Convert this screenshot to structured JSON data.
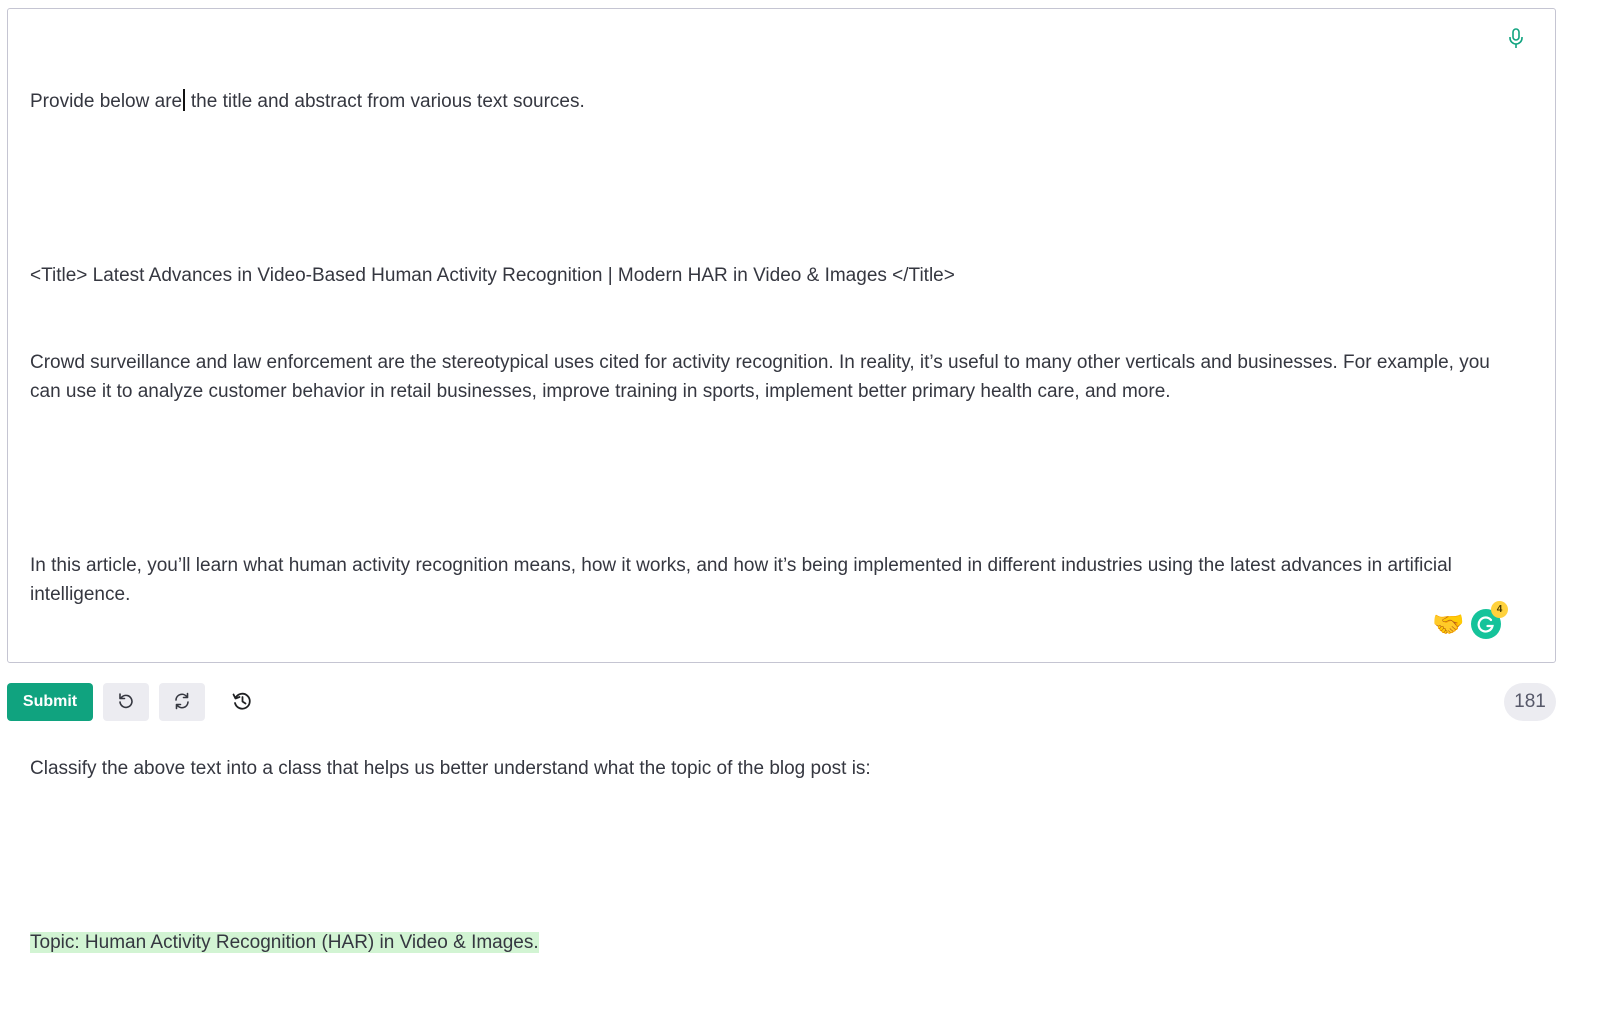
{
  "editor": {
    "line1_before_cursor": "Provide below are",
    "line1_after_cursor": " the title and abstract from various text sources.",
    "title_line": "<Title> Latest Advances in Video-Based Human Activity Recognition | Modern HAR in Video & Images </Title>",
    "paragraph1": "Crowd surveillance and law enforcement are the stereotypical uses cited for activity recognition. In reality, it’s useful to many other verticals and businesses. For example, you can use it to analyze customer behavior in retail businesses, improve training in sports, implement better primary health care, and more.",
    "paragraph2": "In this article, you’ll learn what human activity recognition means, how it works, and how it’s being implemented in different industries using the latest advances in artificial intelligence.",
    "instruction": "Classify the above text into a class that helps us better understand what the topic of the blog post is:",
    "completion": "Topic: Human Activity Recognition (HAR) in Video & Images."
  },
  "icons": {
    "mic": "microphone-icon",
    "handshake": "handshake-emoji",
    "handshake_glyph": "🤝",
    "grammarly": "grammarly-icon"
  },
  "grammarly": {
    "badge_count": "4"
  },
  "toolbar": {
    "submit_label": "Submit",
    "undo": "undo-icon",
    "regenerate": "regenerate-icon",
    "history": "history-icon"
  },
  "status": {
    "token_count": "181"
  },
  "colors": {
    "accent": "#10a37f",
    "completion_highlight": "#d2f4d3",
    "grammarly": "#15c39a"
  }
}
